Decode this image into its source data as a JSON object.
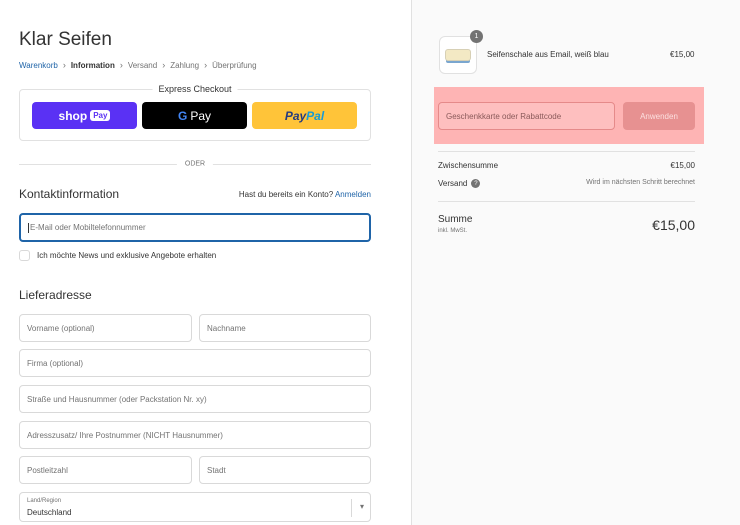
{
  "shop": {
    "title": "Klar Seifen"
  },
  "breadcrumb": {
    "items": [
      {
        "label": "Warenkorb"
      },
      {
        "label": "Information"
      },
      {
        "label": "Versand"
      },
      {
        "label": "Zahlung"
      },
      {
        "label": "Überprüfung"
      }
    ],
    "separator": "›"
  },
  "express": {
    "label": "Express Checkout",
    "shoppay": {
      "label": "shop",
      "pill": "Pay"
    },
    "gpay": {
      "label": "Pay"
    },
    "paypal": {
      "part1": "Pay",
      "part2": "Pal"
    }
  },
  "divider": {
    "label": "ODER"
  },
  "contact": {
    "title": "Kontaktinformation",
    "login_prompt": "Hast du bereits ein Konto?",
    "login_link": "Anmelden",
    "email_placeholder": "E-Mail oder Mobiltelefonnummer",
    "newsletter_label": "Ich möchte News und exklusive Angebote erhalten"
  },
  "shipping": {
    "title": "Lieferadresse",
    "first_name": "Vorname (optional)",
    "last_name": "Nachname",
    "company": "Firma (optional)",
    "street": "Straße und Hausnummer (oder Packstation Nr. xy)",
    "address2": "Adresszusatz/ Ihre Postnummer (NICHT Hausnummer)",
    "zip": "Postleitzahl",
    "city": "Stadt",
    "country_label": "Land/Region",
    "country_value": "Deutschland"
  },
  "cart": {
    "item": {
      "name": "Seifenschale aus Email, weiß blau",
      "price": "€15,00",
      "quantity": "1"
    },
    "discount_placeholder": "Geschenkkarte oder Rabattcode",
    "apply_label": "Anwenden",
    "subtotal_label": "Zwischensumme",
    "subtotal_value": "€15,00",
    "shipping_label": "Versand",
    "shipping_note": "Wird im nächsten Schritt berechnet",
    "total_label": "Summe",
    "total_sub": "inkl. MwSt.",
    "total_value": "€15,00"
  },
  "colors": {
    "link": "#1f64a8",
    "shoppay": "#5a31f4",
    "paypal": "#ffc439",
    "highlight": "#ff9696"
  }
}
